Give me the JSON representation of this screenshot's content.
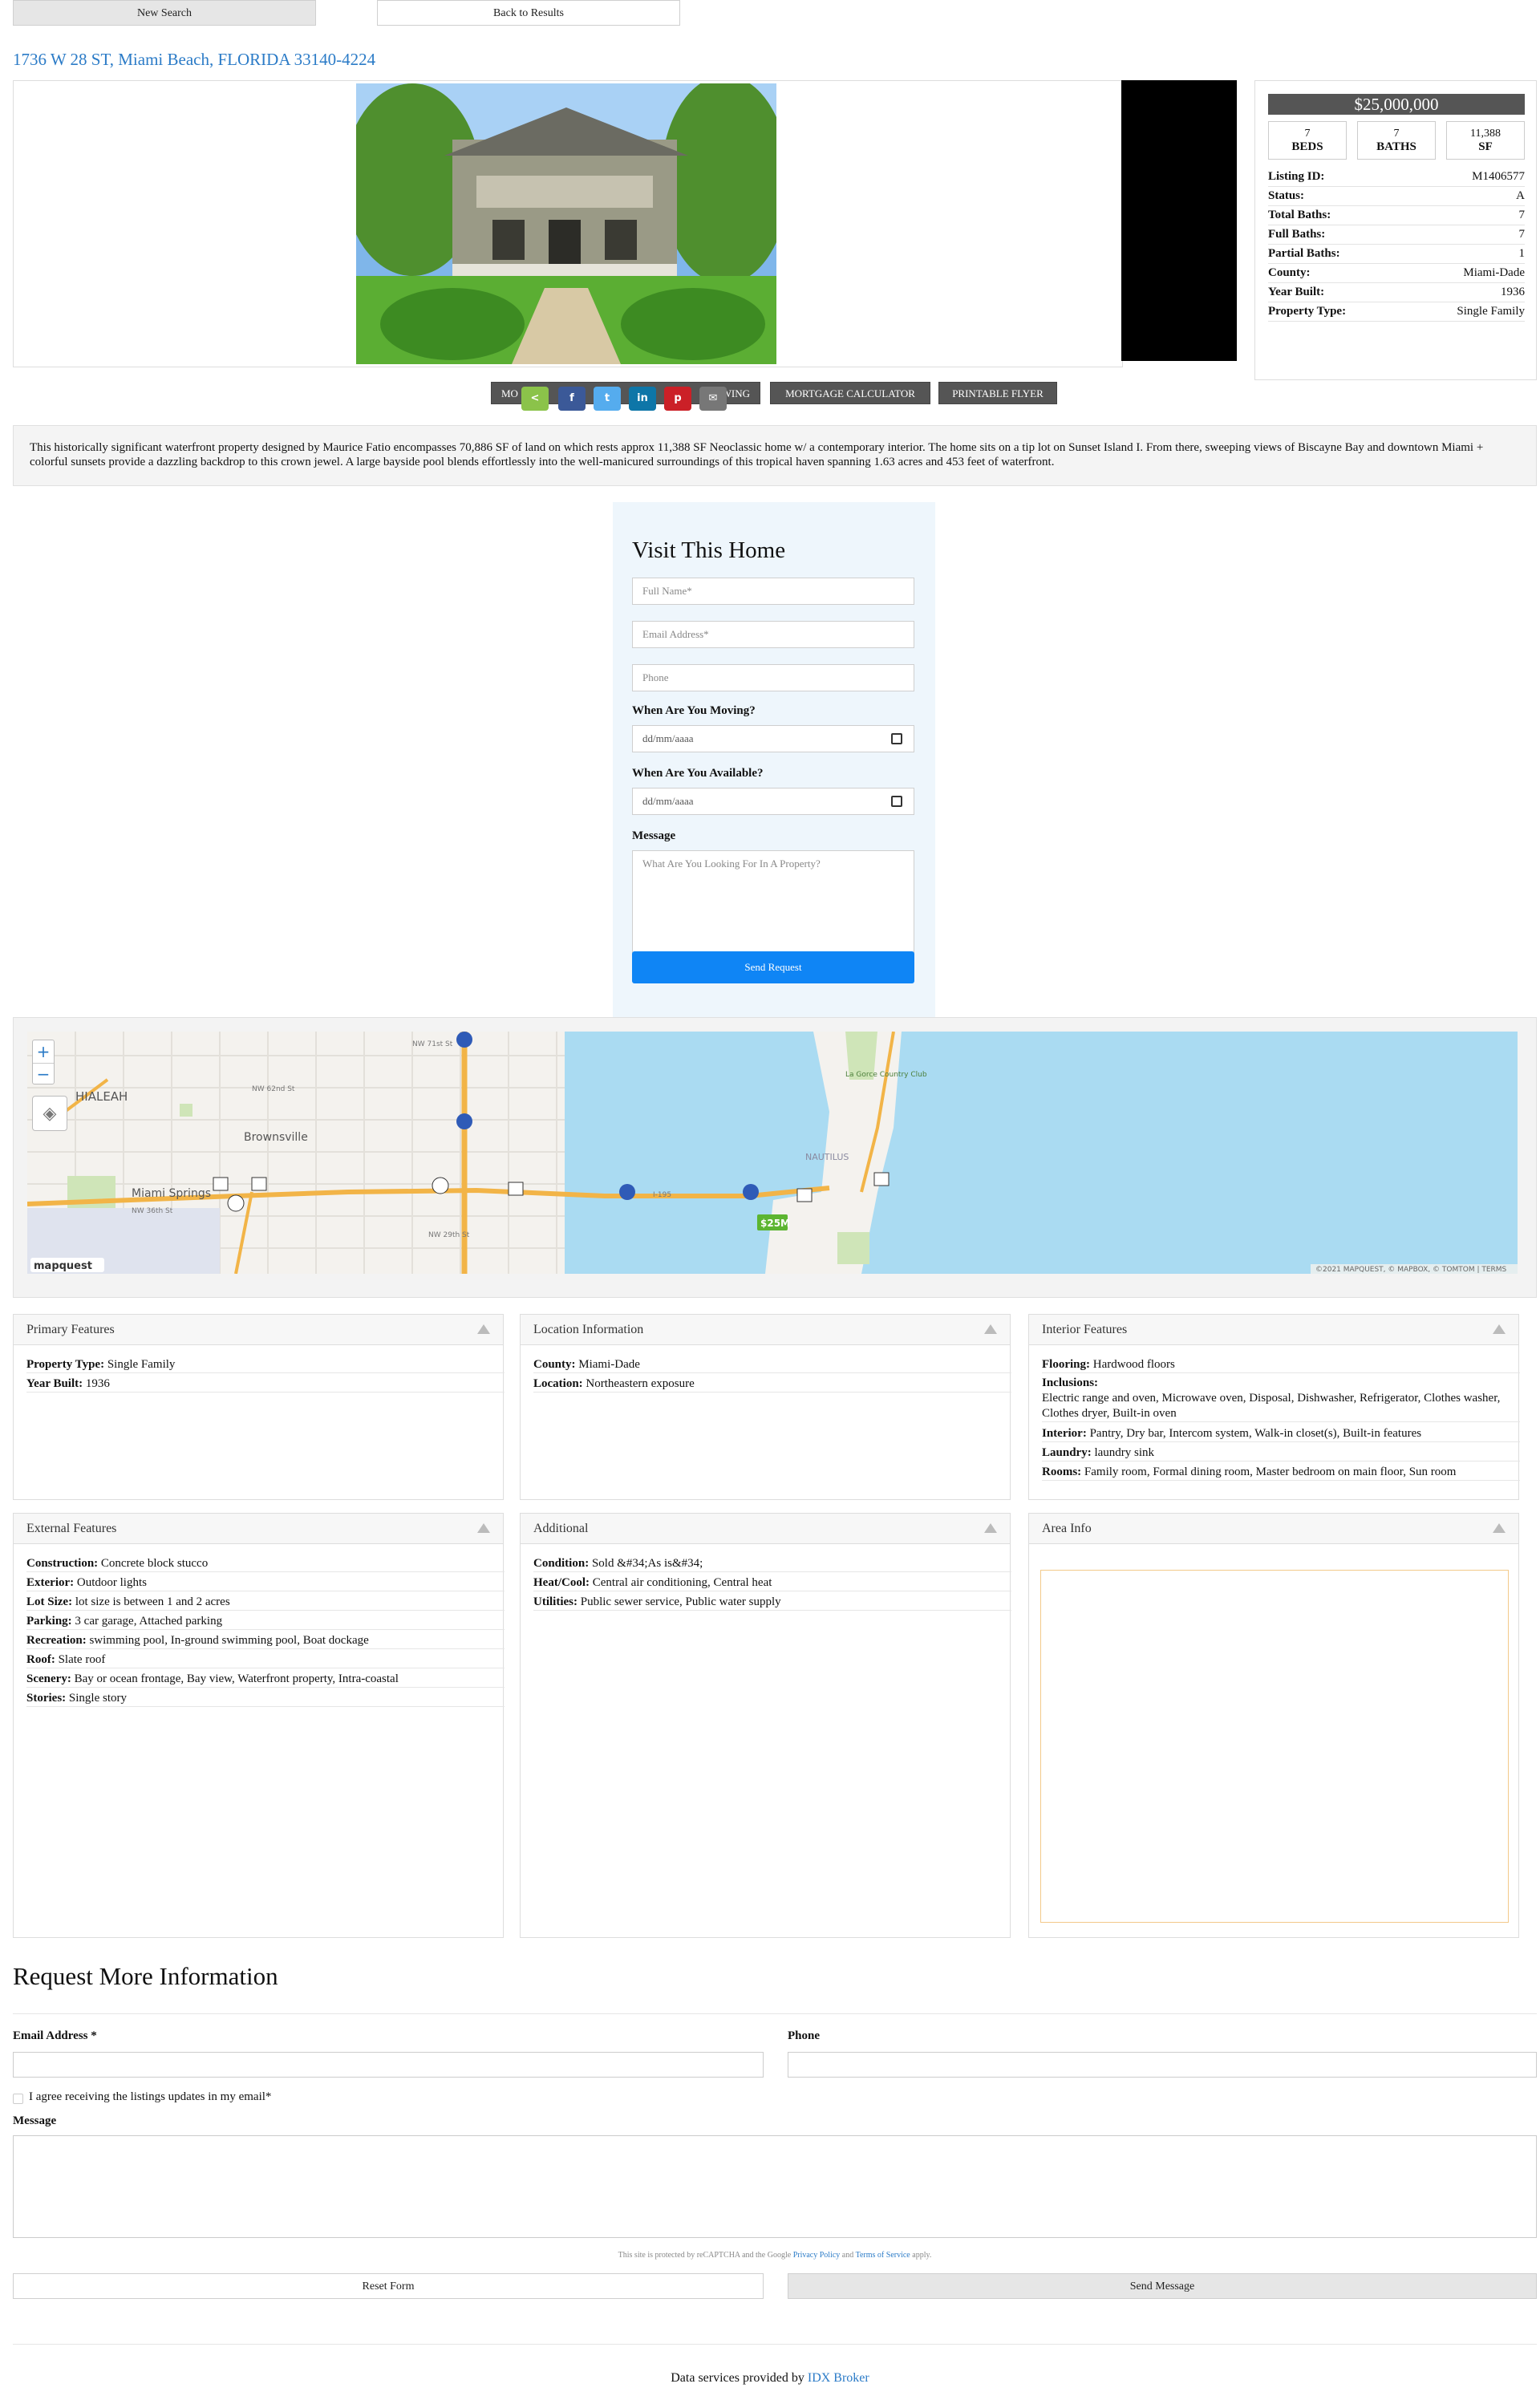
{
  "nav": {
    "new_search": "New Search",
    "back_results": "Back to Results"
  },
  "address": "1736 W 28 ST, Miami Beach, FLORIDA 33140-4224",
  "summary": {
    "price": "$25,000,000",
    "beds_value": "7",
    "beds_label": "BEDS",
    "baths_value": "7",
    "baths_label": "BATHS",
    "sf_value": "11,388",
    "sf_label": "SF",
    "details": [
      {
        "k": "Listing ID:",
        "v": "M1406577"
      },
      {
        "k": "Status:",
        "v": "A"
      },
      {
        "k": "Total Baths:",
        "v": "7"
      },
      {
        "k": "Full Baths:",
        "v": "7"
      },
      {
        "k": "Partial Baths:",
        "v": "1"
      },
      {
        "k": "County:",
        "v": "Miami-Dade"
      },
      {
        "k": "Year Built:",
        "v": "1936"
      },
      {
        "k": "Property Type:",
        "v": "Single Family"
      }
    ]
  },
  "actions": {
    "more": "MO",
    "showing": "WING",
    "mortgage": "MORTGAGE CALCULATOR",
    "flyer": "PRINTABLE FLYER"
  },
  "description": "This historically significant waterfront property designed by Maurice Fatio encompasses 70,886 SF of land on which rests approx 11,388 SF Neoclassic home w/ a contemporary interior. The home sits on a tip lot on Sunset Island I. From there, sweeping views of Biscayne Bay and downtown Miami + colorful sunsets provide a dazzling backdrop to this crown jewel. A large bayside pool blends effortlessly into the well-manicured surroundings of this tropical haven spanning 1.63 acres and 453 feet of waterfront.",
  "visit": {
    "title": "Visit This Home",
    "name_ph": "Full Name*",
    "email_ph": "Email Address*",
    "phone_ph": "Phone",
    "moving_label": "When Are You Moving?",
    "available_label": "When Are You Available?",
    "date_ph": "dd/mm/aaaa",
    "message_label": "Message",
    "message_ph": "What Are You Looking For In A Property?",
    "submit": "Send Request"
  },
  "map": {
    "zoom_in": "+",
    "zoom_out": "−",
    "labels": {
      "hialeah": "HIALEAH",
      "brownsville": "Brownsville",
      "miami_springs": "Miami Springs",
      "nautilus": "NAUTILUS",
      "price_pin": "$25M",
      "la_gorce": "La Gorce Country Club",
      "nw71": "NW 71st St",
      "nw62": "NW 62nd St",
      "nw36": "NW 36th St",
      "nw29": "NW 29th St",
      "i195": "I-195"
    },
    "attribution": "©2021 MAPQUEST, © MAPBOX, © TOMTOM | TERMS",
    "logo": "mapquest"
  },
  "primary": {
    "title": "Primary Features",
    "rows": [
      {
        "k": "Property Type:",
        "v": "Single Family"
      },
      {
        "k": "Year Built:",
        "v": "1936"
      }
    ]
  },
  "location": {
    "title": "Location Information",
    "rows": [
      {
        "k": "County:",
        "v": "Miami-Dade"
      },
      {
        "k": "Location:",
        "v": "Northeastern exposure"
      }
    ]
  },
  "interior": {
    "title": "Interior Features",
    "rows": [
      {
        "k": "Flooring:",
        "v": "Hardwood floors"
      },
      {
        "k": "Inclusions:",
        "v": "Electric range and oven, Microwave oven, Disposal, Dishwasher, Refrigerator, Clothes washer, Clothes dryer, Built-in oven"
      },
      {
        "k": "Interior:",
        "v": "Pantry, Dry bar, Intercom system, Walk-in closet(s), Built-in features"
      },
      {
        "k": "Laundry:",
        "v": "laundry sink"
      },
      {
        "k": "Rooms:",
        "v": "Family room, Formal dining room, Master bedroom on main floor, Sun room"
      }
    ]
  },
  "external": {
    "title": "External Features",
    "rows": [
      {
        "k": "Construction:",
        "v": "Concrete block stucco"
      },
      {
        "k": "Exterior:",
        "v": "Outdoor lights"
      },
      {
        "k": "Lot Size:",
        "v": "lot size is between 1 and 2 acres"
      },
      {
        "k": "Parking:",
        "v": "3 car garage, Attached parking"
      },
      {
        "k": "Recreation:",
        "v": "swimming pool, In-ground swimming pool, Boat dockage"
      },
      {
        "k": "Roof:",
        "v": "Slate roof"
      },
      {
        "k": "Scenery:",
        "v": "Bay or ocean frontage, Bay view, Waterfront property, Intra-coastal"
      },
      {
        "k": "Stories:",
        "v": "Single story"
      }
    ]
  },
  "additional": {
    "title": "Additional",
    "rows": [
      {
        "k": "Condition:",
        "v": "Sold &#34;As is&#34;"
      },
      {
        "k": "Heat/Cool:",
        "v": "Central air conditioning, Central heat"
      },
      {
        "k": "Utilities:",
        "v": "Public sewer service, Public water supply"
      }
    ]
  },
  "area": {
    "title": "Area Info"
  },
  "request": {
    "title": "Request More Information",
    "email_label": "Email Address *",
    "phone_label": "Phone",
    "agree": "I agree receiving the listings updates in my email*",
    "message_label": "Message",
    "captcha_pre": "This site is protected by reCAPTCHA and the Google",
    "privacy": "Privacy Policy",
    "and": "and",
    "terms": "Terms of Service",
    "apply": "apply.",
    "reset": "Reset Form",
    "send": "Send Message"
  },
  "footer": {
    "text": "Data services provided by",
    "link": "IDX Broker"
  }
}
